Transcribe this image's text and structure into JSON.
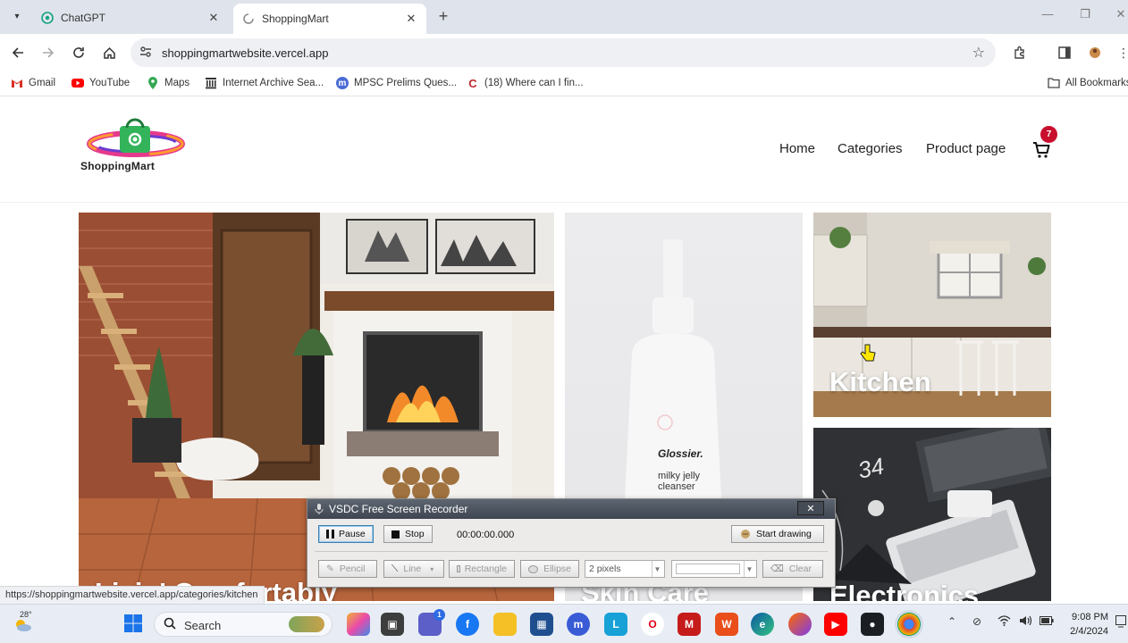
{
  "browser": {
    "tabs": [
      {
        "title": "ChatGPT",
        "active": false
      },
      {
        "title": "ShoppingMart",
        "active": true
      }
    ],
    "url": "shoppingmartwebsite.vercel.app",
    "bookmarks": [
      {
        "label": "Gmail"
      },
      {
        "label": "YouTube"
      },
      {
        "label": "Maps"
      },
      {
        "label": "Internet Archive Sea..."
      },
      {
        "label": "MPSC Prelims Ques..."
      },
      {
        "label": "(18) Where can I fin..."
      }
    ],
    "all_bookmarks": "All Bookmarks",
    "status_url": "https://shoppingmartwebsite.vercel.app/categories/kitchen"
  },
  "site": {
    "logo_text": "ShoppingMart",
    "nav": [
      "Home",
      "Categories",
      "Product page"
    ],
    "cart_count": "7",
    "categories": {
      "living": "Livin' Comfortably",
      "skin": "Skin Care",
      "kitchen": "Kitchen",
      "electronics": "Electronics"
    },
    "product_brand": "Glossier.",
    "product_name_1": "milky jelly",
    "product_name_2": "cleanser",
    "notebook_text": "34"
  },
  "recorder": {
    "title": "VSDC Free Screen Recorder",
    "close": "✕",
    "pause": "Pause",
    "stop": "Stop",
    "timer": "00:00:00.000",
    "start_drawing": "Start drawing",
    "pencil": "Pencil",
    "line": "Line",
    "rectangle": "Rectangle",
    "ellipse": "Ellipse",
    "width": "2 pixels",
    "clear": "Clear"
  },
  "taskbar": {
    "weather": "28°",
    "search": "Search",
    "chat_badge": "1",
    "time": "9:08 PM",
    "date": "2/4/2024"
  }
}
